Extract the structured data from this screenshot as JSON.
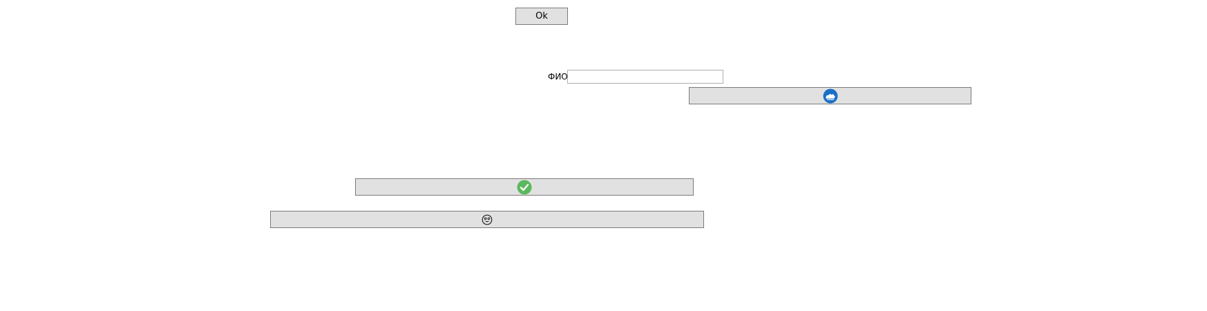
{
  "ok_button": {
    "label": "Ok"
  },
  "fio_field": {
    "label": "ФИО",
    "value": "",
    "placeholder": ""
  },
  "buttons": [
    {
      "icon": "blue-cloud-icon",
      "color": "#1a6fc7"
    },
    {
      "icon": "green-check-icon",
      "color": "#5cb85c"
    },
    {
      "icon": "emoji-face-icon",
      "color": "#222222"
    }
  ]
}
